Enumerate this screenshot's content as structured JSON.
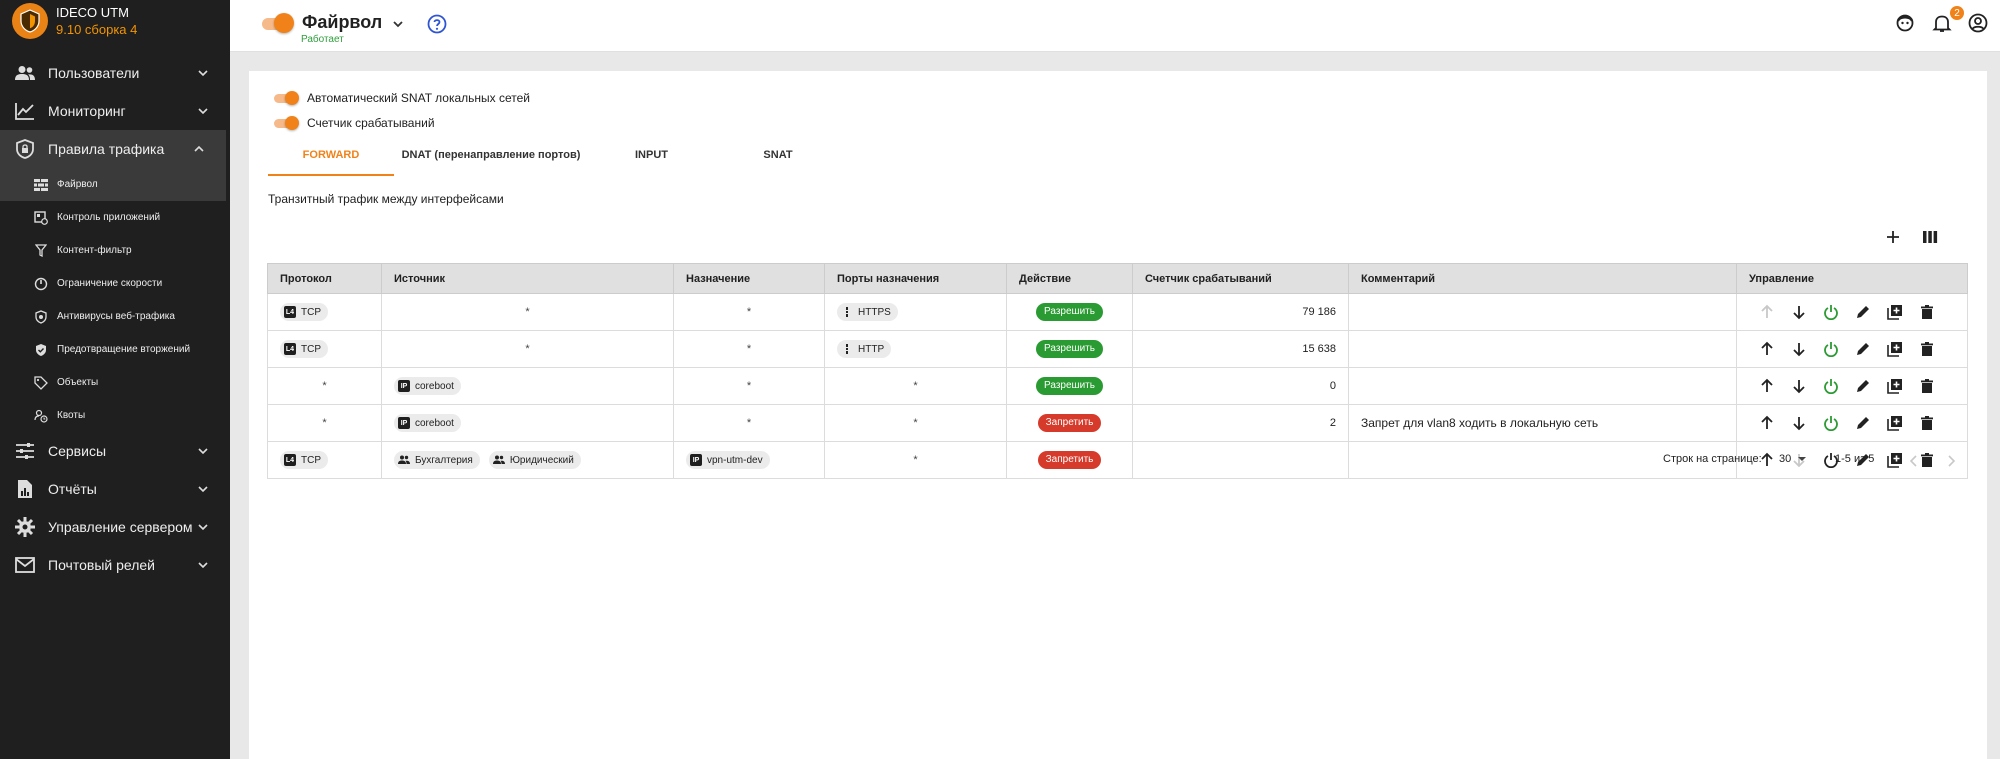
{
  "app": {
    "name": "IDECO UTM",
    "version": "9.10 сборка 4"
  },
  "sidebar": {
    "items": [
      {
        "label": "Пользователи",
        "icon": "users-icon"
      },
      {
        "label": "Мониторинг",
        "icon": "chart-line-icon"
      },
      {
        "label": "Правила трафика",
        "icon": "shield-lock-icon"
      },
      {
        "label": "Сервисы",
        "icon": "sliders-icon"
      },
      {
        "label": "Отчёты",
        "icon": "report-icon"
      },
      {
        "label": "Управление сервером",
        "icon": "gear-icon"
      },
      {
        "label": "Почтовый релей",
        "icon": "mail-icon"
      }
    ],
    "subitems": [
      {
        "label": "Файрвол",
        "icon": "firewall-icon"
      },
      {
        "label": "Контроль приложений",
        "icon": "app-control-icon"
      },
      {
        "label": "Контент-фильтр",
        "icon": "filter-icon"
      },
      {
        "label": "Ограничение скорости",
        "icon": "speed-icon"
      },
      {
        "label": "Антивирусы веб-трафика",
        "icon": "antivirus-icon"
      },
      {
        "label": "Предотвращение вторжений",
        "icon": "shield-check-icon"
      },
      {
        "label": "Объекты",
        "icon": "tag-icon"
      },
      {
        "label": "Квоты",
        "icon": "quota-icon"
      }
    ]
  },
  "topbar": {
    "title": "Файрвол",
    "status": "Работает",
    "notifications_count": "2",
    "colors": {
      "accent": "#f08219",
      "status_ok": "#2e9e3b"
    }
  },
  "settings": {
    "snat_label": "Автоматический SNAT локальных сетей",
    "counter_label": "Счетчик срабатываний"
  },
  "tabs": [
    {
      "label": "FORWARD"
    },
    {
      "label": "DNAT (перенаправление портов)"
    },
    {
      "label": "INPUT"
    },
    {
      "label": "SNAT"
    }
  ],
  "subtitle": "Транзитный трафик между интерфейсами",
  "table": {
    "headers": [
      "Протокол",
      "Источник",
      "Назначение",
      "Порты назначения",
      "Действие",
      "Счетчик срабатываний",
      "Комментарий",
      "Управление"
    ],
    "rows": [
      {
        "protocol": "TCP",
        "source": "*",
        "dest": "*",
        "ports": "HTTPS",
        "action": "Разрешить",
        "count": "79 186",
        "comment": ""
      },
      {
        "protocol": "TCP",
        "source": "*",
        "dest": "*",
        "ports": "HTTP",
        "action": "Разрешить",
        "count": "15 638",
        "comment": ""
      },
      {
        "protocol": "*",
        "source": "coreboot",
        "dest": "*",
        "ports": "*",
        "action": "Разрешить",
        "count": "0",
        "comment": ""
      },
      {
        "protocol": "*",
        "source": "coreboot",
        "dest": "*",
        "ports": "*",
        "action": "Запретить",
        "count": "2",
        "comment": "Запрет для vlan8 ходить в локальную сеть"
      },
      {
        "protocol": "TCP",
        "source": "Бухгалтерия",
        "source2": "Юридический",
        "dest": "vpn-utm-dev",
        "ports": "*",
        "action": "Запретить",
        "count": "",
        "comment": ""
      }
    ],
    "chip_tags": {
      "l4": "L4",
      "ip": "IP"
    }
  },
  "pagination": {
    "rows_label": "Строк на странице:",
    "rows_value": "30",
    "range": "1-5 из 5"
  }
}
